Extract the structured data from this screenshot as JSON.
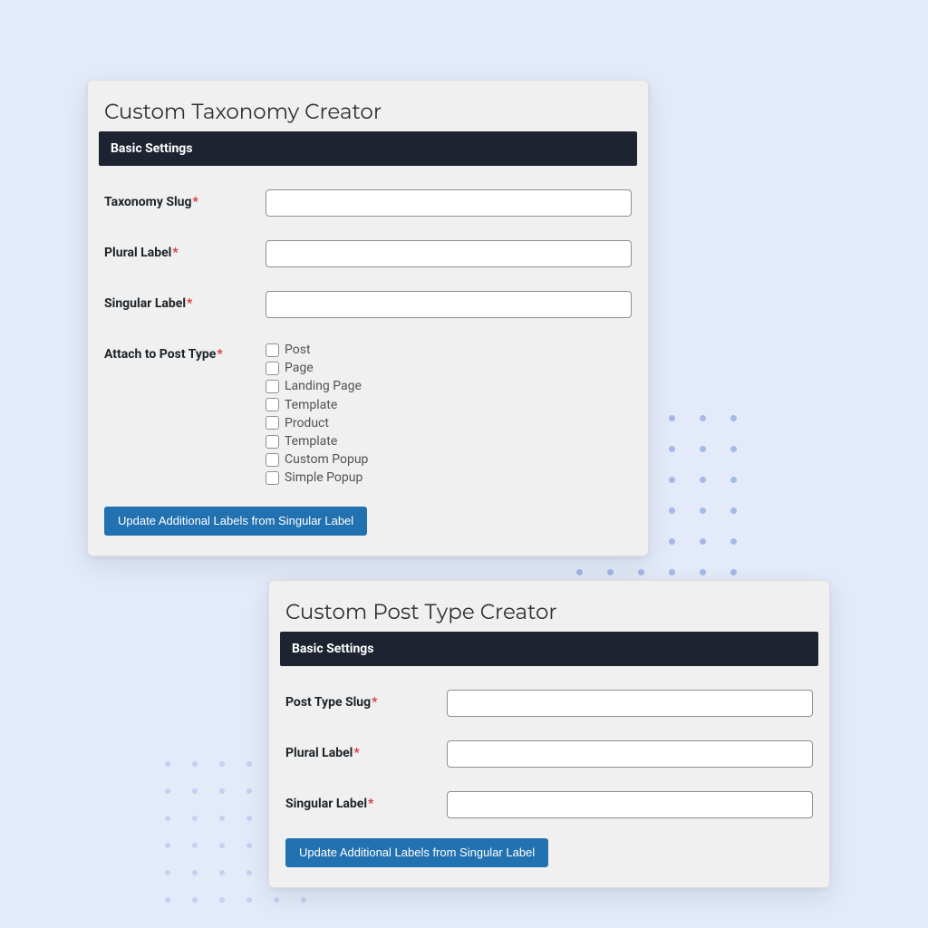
{
  "colors": {
    "page_bg": "#e3ebfa",
    "header_bg": "#1d2331",
    "button_bg": "#2271b1",
    "required": "#d63638"
  },
  "cards": {
    "taxonomy": {
      "title": "Custom Taxonomy Creator",
      "section_header": "Basic Settings",
      "fields": {
        "slug": {
          "label": "Taxonomy Slug",
          "required": true,
          "value": ""
        },
        "plural": {
          "label": "Plural Label",
          "required": true,
          "value": ""
        },
        "singular": {
          "label": "Singular Label",
          "required": true,
          "value": ""
        },
        "post_types": {
          "label": "Attach to Post Type",
          "required": true,
          "options": [
            {
              "label": "Post",
              "checked": false
            },
            {
              "label": "Page",
              "checked": false
            },
            {
              "label": "Landing Page",
              "checked": false
            },
            {
              "label": "Template",
              "checked": false
            },
            {
              "label": "Product",
              "checked": false
            },
            {
              "label": "Template",
              "checked": false
            },
            {
              "label": "Custom Popup",
              "checked": false
            },
            {
              "label": "Simple Popup",
              "checked": false
            }
          ]
        }
      },
      "button_label": "Update Additional Labels from Singular Label"
    },
    "cpt": {
      "title": "Custom Post Type Creator",
      "section_header": "Basic Settings",
      "fields": {
        "slug": {
          "label": "Post Type Slug",
          "required": true,
          "value": ""
        },
        "plural": {
          "label": "Plural Label",
          "required": true,
          "value": ""
        },
        "singular": {
          "label": "Singular Label",
          "required": true,
          "value": ""
        }
      },
      "button_label": "Update Additional Labels from Singular Label"
    }
  }
}
